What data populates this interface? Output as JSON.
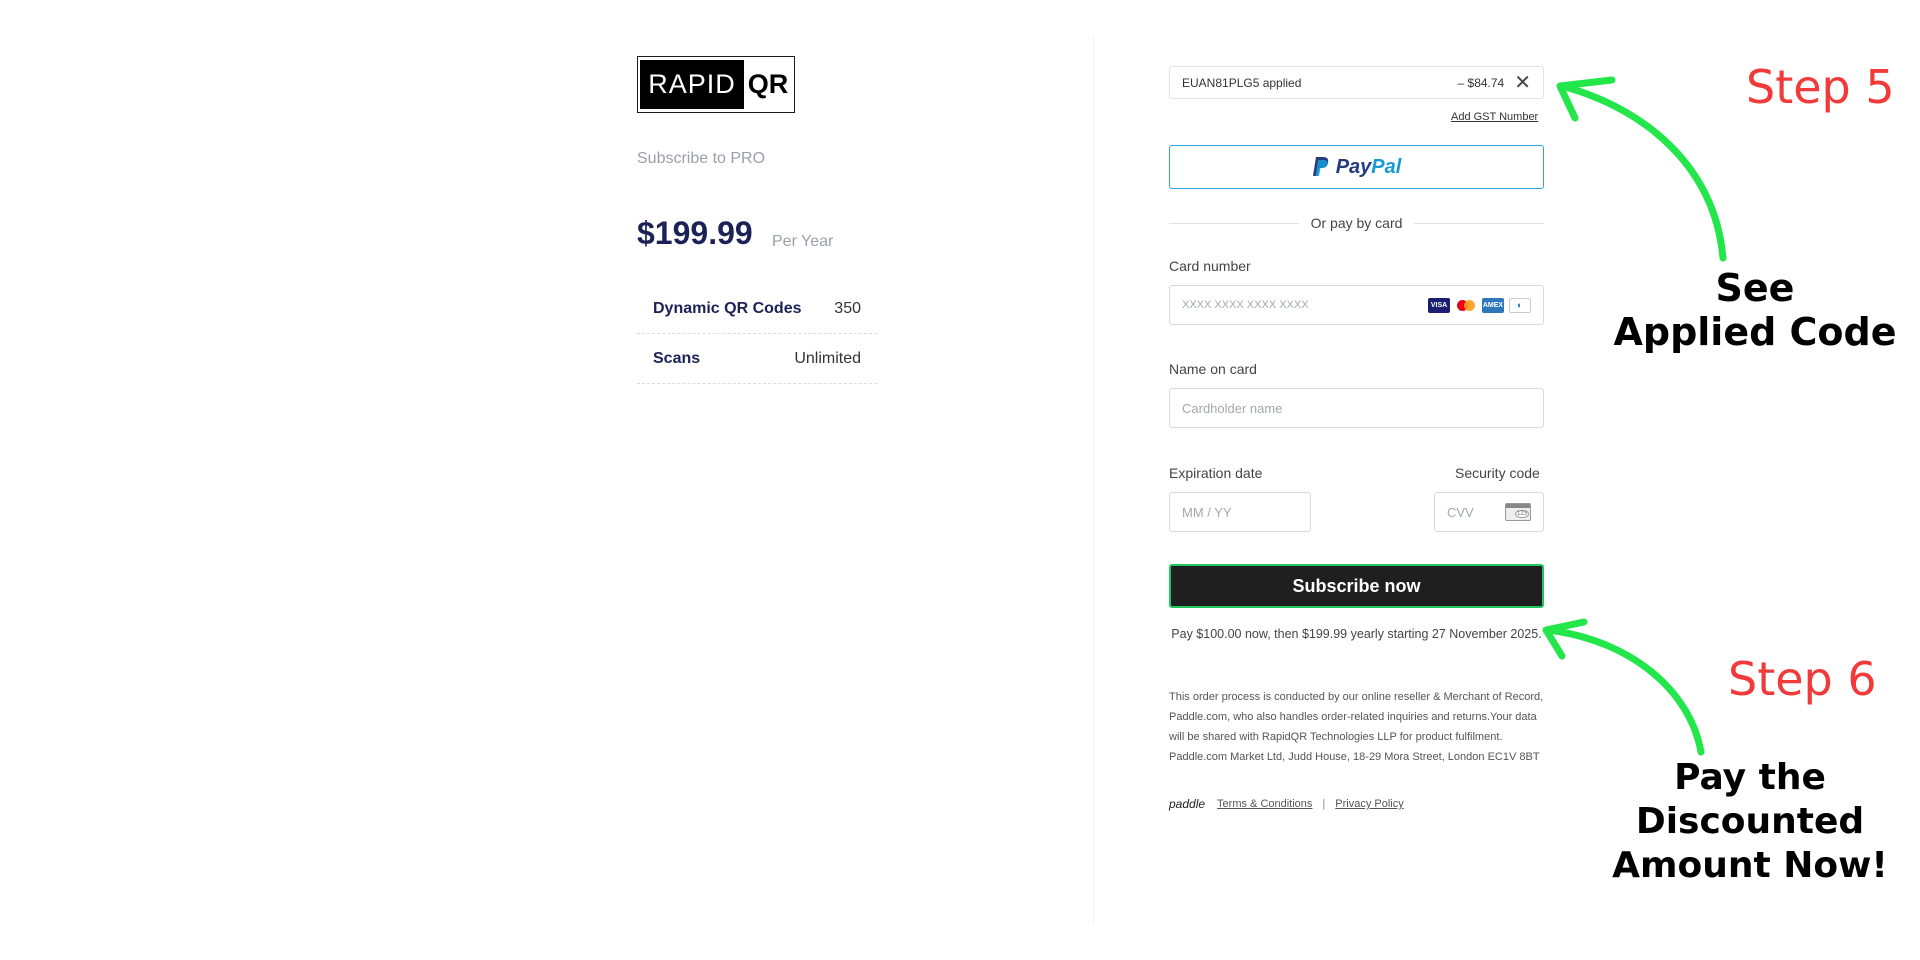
{
  "brand": {
    "logo_left": "RAPID",
    "logo_right": "QR"
  },
  "summary": {
    "subscribe_to": "Subscribe to PRO",
    "price": "$199.99",
    "period": "Per Year",
    "features": [
      {
        "label": "Dynamic QR Codes",
        "value": "350"
      },
      {
        "label": "Scans",
        "value": "Unlimited"
      }
    ]
  },
  "checkout": {
    "coupon": {
      "code_text": "EUAN81PLG5 applied",
      "amount": "– $84.74",
      "remove_icon": "close-icon"
    },
    "gst_link": "Add GST Number",
    "paypal": {
      "word_a": "Pay",
      "word_b": "Pal"
    },
    "divider_text": "Or pay by card",
    "card_number": {
      "label": "Card number",
      "placeholder": "XXXX XXXX XXXX XXXX"
    },
    "name_on_card": {
      "label": "Name on card",
      "placeholder": "Cardholder name"
    },
    "expiration": {
      "label": "Expiration date",
      "placeholder": "MM / YY"
    },
    "security": {
      "label": "Security code",
      "placeholder": "CVV"
    },
    "card_brands": [
      "VISA",
      "mastercard",
      "AMEX",
      "diners"
    ],
    "subscribe_button": "Subscribe now",
    "pay_note": "Pay $100.00 now, then $199.99 yearly starting 27 November 2025.",
    "legal": "This order process is conducted by our online reseller & Merchant of Record, Paddle.com, who also handles order-related inquiries and returns.Your data will be shared with RapidQR Technologies LLP for product fulfilment. Paddle.com Market Ltd, Judd House, 18-29 Mora Street, London EC1V 8BT",
    "footer": {
      "paddle": "paddle",
      "terms": "Terms & Conditions",
      "sep": "|",
      "privacy": "Privacy Policy"
    }
  },
  "annotations": {
    "step5": "Step 5",
    "see_line1": "See",
    "see_line2": "Applied Code",
    "step6": "Step 6",
    "pay_line1": "Pay the",
    "pay_line2": "Discounted",
    "pay_line3": "Amount Now!"
  },
  "colors": {
    "accent_green": "#22c55e",
    "step_red": "#f23a3a",
    "price_navy": "#1c2256",
    "paypal_blue": "#2fa4e7"
  }
}
